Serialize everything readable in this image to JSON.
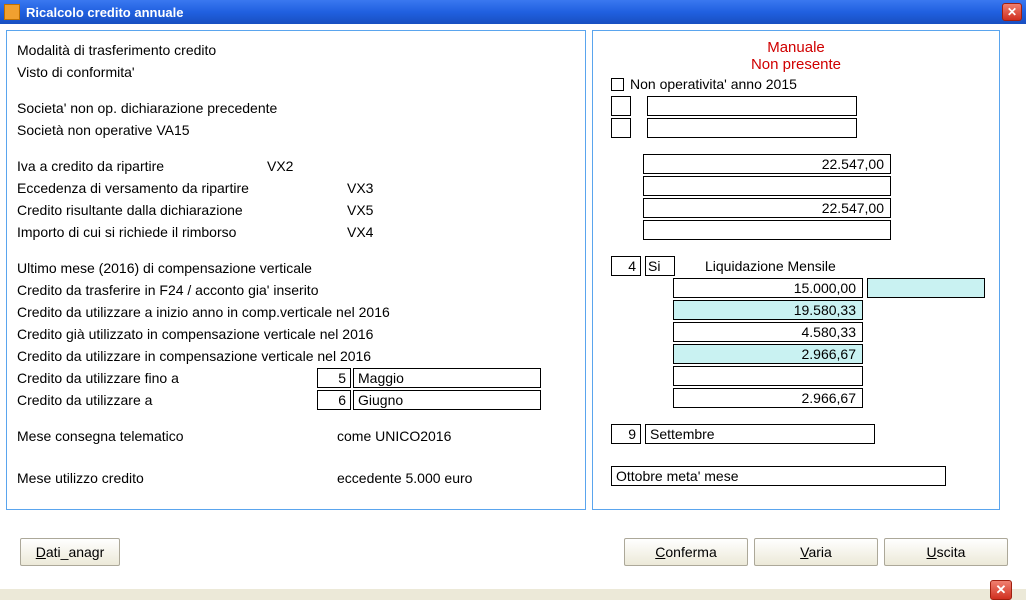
{
  "window": {
    "title": "Ricalcolo credito annuale"
  },
  "left": {
    "modalita": "Modalità di trasferimento credito",
    "visto": "Visto di conformita'",
    "soc_nonop_prec": "Societa' non op. dichiarazione precedente",
    "soc_nonop_va15": "Società non operative VA15",
    "iva_credito": "Iva a credito da ripartire",
    "iva_credito_code": "VX2",
    "eccedenza": "Eccedenza di versamento da ripartire",
    "eccedenza_code": "VX3",
    "credito_ris": "Credito risultante dalla dichiarazione",
    "credito_ris_code": "VX5",
    "importo_rimb": "Importo di cui si richiede il rimborso",
    "importo_rimb_code": "VX4",
    "ultimo_mese": "Ultimo mese (2016) di compensazione verticale",
    "cred_f24": "Credito da trasferire in F24 / acconto gia' inserito",
    "cred_inizio": "Credito da utilizzare a inizio anno in comp.verticale nel 2016",
    "cred_gia": "Credito già utilizzato in compensazione verticale nel 2016",
    "cred_util_comp": "Credito da utilizzare in compensazione verticale nel 2016",
    "cred_fino_a": "Credito da utilizzare fino a",
    "cred_fino_a_num": "5",
    "cred_fino_a_month": "Maggio",
    "cred_a": "Credito da utilizzare a",
    "cred_a_num": "6",
    "cred_a_month": "Giugno",
    "telematico": "Mese consegna telematico",
    "telematico_sub": "come UNICO2016",
    "mese_util": "Mese utilizzo credito",
    "mese_util_sub": "eccedente  5.000 euro"
  },
  "right": {
    "manuale": "Manuale",
    "non_presente": "Non presente",
    "nonop2015": "Non operativita' anno 2015",
    "val_iva": "22.547,00",
    "val_ecc": "",
    "val_ris": "22.547,00",
    "val_rimb": "",
    "ultimo_num": "4",
    "ultimo_si": "Si",
    "liq_label": "Liquidazione Mensile",
    "val_f24": "15.000,00",
    "val_inizio": "19.580,33",
    "val_gia": "4.580,33",
    "val_comp": "2.966,67",
    "val_finoa": "",
    "val_a": "2.966,67",
    "tel_num": "9",
    "tel_month": "Settembre",
    "mese_util_val": "Ottobre meta' mese"
  },
  "buttons": {
    "dati": "Dati_anagr",
    "conferma": "Conferma",
    "varia": "Varia",
    "uscita": "Uscita"
  }
}
